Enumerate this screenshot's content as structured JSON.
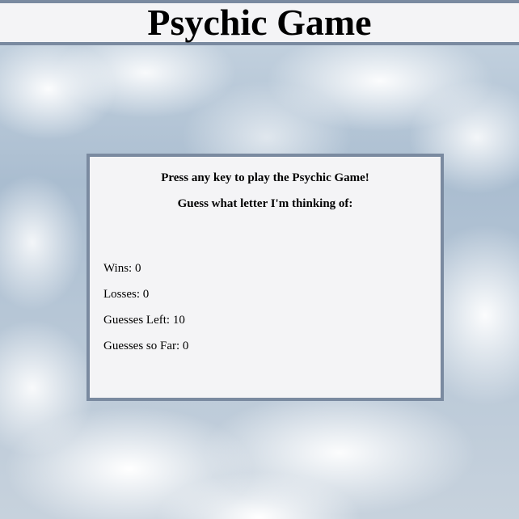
{
  "header": {
    "title": "Psychic Game"
  },
  "game": {
    "prompt_start": "Press any key to play the Psychic Game!",
    "prompt_guess": "Guess what letter I'm thinking of:",
    "stats": {
      "wins_label": "Wins: ",
      "wins": "0",
      "losses_label": "Losses: ",
      "losses": "0",
      "guesses_left_label": "Guesses Left: ",
      "guesses_left": "10",
      "guesses_so_far_label": "Guesses so Far: ",
      "guesses_so_far": "0"
    }
  },
  "colors": {
    "border": "#7a8aa0",
    "panel_bg": "#f4f4f6"
  }
}
